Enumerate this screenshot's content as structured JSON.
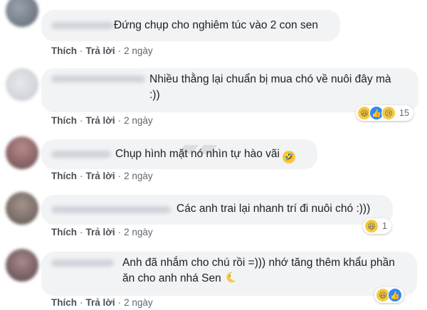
{
  "actions": {
    "like": "Thích",
    "reply": "Trả lời",
    "separator": "·"
  },
  "comments": [
    {
      "text": "Đứng chụp cho nghiêm túc vào 2 con sen",
      "time": "2 ngày",
      "reactions": null
    },
    {
      "text": "Nhiều thằng lại chuẩn bị mua chó về nuôi đây mà\n:))",
      "time": "2 ngày",
      "reactions": {
        "types": [
          "haha-icon",
          "like-icon",
          "sad-icon"
        ],
        "count": "15"
      }
    },
    {
      "text": "Chụp hình mặt nó nhìn tự hào vãi",
      "time": "2 ngày",
      "reactions": null,
      "emoji": "rofl-emoji"
    },
    {
      "text": "Các anh trai lại nhanh trí đi nuôi chó :)))",
      "time": "2 ngày",
      "reactions": {
        "types": [
          "haha-icon"
        ],
        "count": "1"
      }
    },
    {
      "text": "Anh đã nhắm cho chú rồi =))) nhớ tăng thêm khẩu phần\năn cho anh nhá Sen",
      "time": "2 ngày",
      "reactions": {
        "types": [
          "haha-icon",
          "like-icon"
        ],
        "count": ""
      },
      "emoji": "crescent-moon-emoji"
    }
  ],
  "colors": {
    "bubble": "#f2f3f5",
    "text": "#1c1e21",
    "meta": "#606770",
    "haha": "#f7c93c",
    "like": "#2d88ff"
  }
}
